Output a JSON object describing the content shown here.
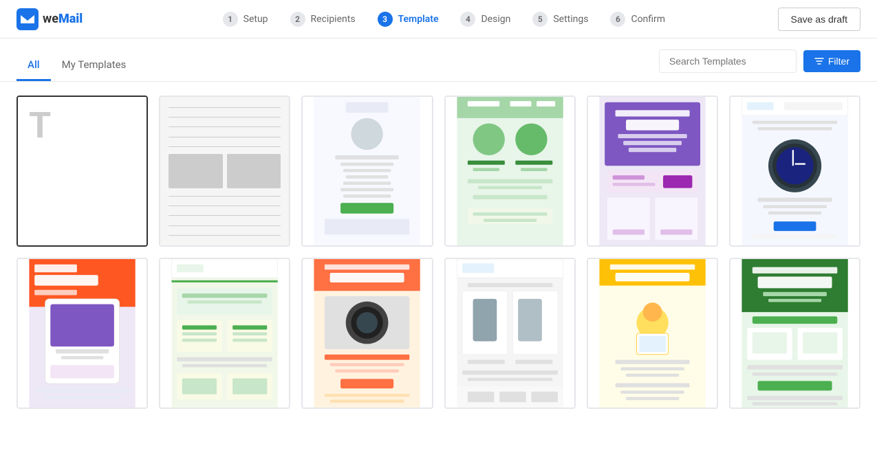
{
  "logo": {
    "text_we": "we",
    "text_mail": "Mail"
  },
  "stepper": {
    "steps": [
      {
        "number": "1",
        "label": "Setup",
        "active": false
      },
      {
        "number": "2",
        "label": "Recipients",
        "active": false
      },
      {
        "number": "3",
        "label": "Template",
        "active": true
      },
      {
        "number": "4",
        "label": "Design",
        "active": false
      },
      {
        "number": "5",
        "label": "Settings",
        "active": false
      },
      {
        "number": "6",
        "label": "Confirm",
        "active": false
      }
    ]
  },
  "header": {
    "save_draft_label": "Save as draft"
  },
  "tabs": {
    "all_label": "All",
    "my_templates_label": "My Templates",
    "active": "All"
  },
  "search": {
    "placeholder": "Search Templates"
  },
  "filter": {
    "label": "Filter",
    "icon": "filter-icon"
  },
  "templates": {
    "row1": [
      {
        "id": "blank",
        "type": "blank",
        "selected": true
      },
      {
        "id": "gray-layout",
        "type": "gray",
        "selected": false
      },
      {
        "id": "appsero",
        "type": "appsero",
        "selected": false
      },
      {
        "id": "green-food",
        "type": "green",
        "selected": false
      },
      {
        "id": "rudys",
        "type": "rudys",
        "selected": false
      },
      {
        "id": "wemail-watch",
        "type": "wemail-watch",
        "selected": false
      }
    ],
    "row2": [
      {
        "id": "product-update",
        "type": "product-update",
        "selected": false
      },
      {
        "id": "wemail-green",
        "type": "wemail-green",
        "selected": false
      },
      {
        "id": "youre-in-luck",
        "type": "youre-in-luck",
        "selected": false
      },
      {
        "id": "tshirt",
        "type": "tshirt",
        "selected": false
      },
      {
        "id": "collaborate",
        "type": "collaborate",
        "selected": false
      },
      {
        "id": "discount",
        "type": "discount",
        "selected": false
      }
    ]
  }
}
